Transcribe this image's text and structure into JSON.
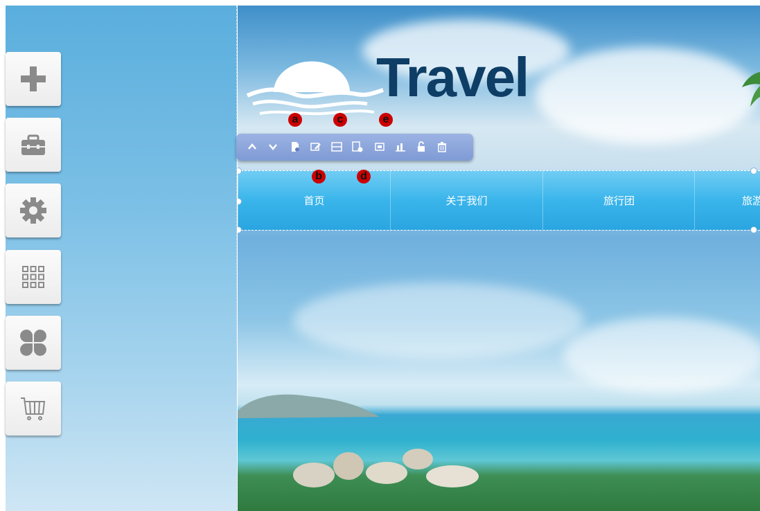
{
  "sidebar": {
    "tools": [
      {
        "icon": "plus-icon"
      },
      {
        "icon": "toolbox-icon"
      },
      {
        "icon": "gear-icon"
      },
      {
        "icon": "grid-icon"
      },
      {
        "icon": "clover-icon"
      },
      {
        "icon": "cart-icon"
      }
    ]
  },
  "site": {
    "logo_text": "Travel",
    "nav": [
      "首页",
      "关于我们",
      "旅行团",
      "旅游"
    ]
  },
  "toolbar": {
    "buttons": [
      "chevron-up-icon",
      "chevron-down-icon",
      "page-icon",
      "edit-icon",
      "layout-icon",
      "settings-icon",
      "frame-icon",
      "chart-icon",
      "lock-icon",
      "delete-icon"
    ],
    "markers": {
      "a": "a",
      "b": "b",
      "c": "c",
      "d": "d",
      "e": "e"
    }
  },
  "colors": {
    "accent": "#2aa5e0",
    "logo": "#0e3e66",
    "marker": "#cc0000",
    "toolbar": "#8aa6db"
  }
}
